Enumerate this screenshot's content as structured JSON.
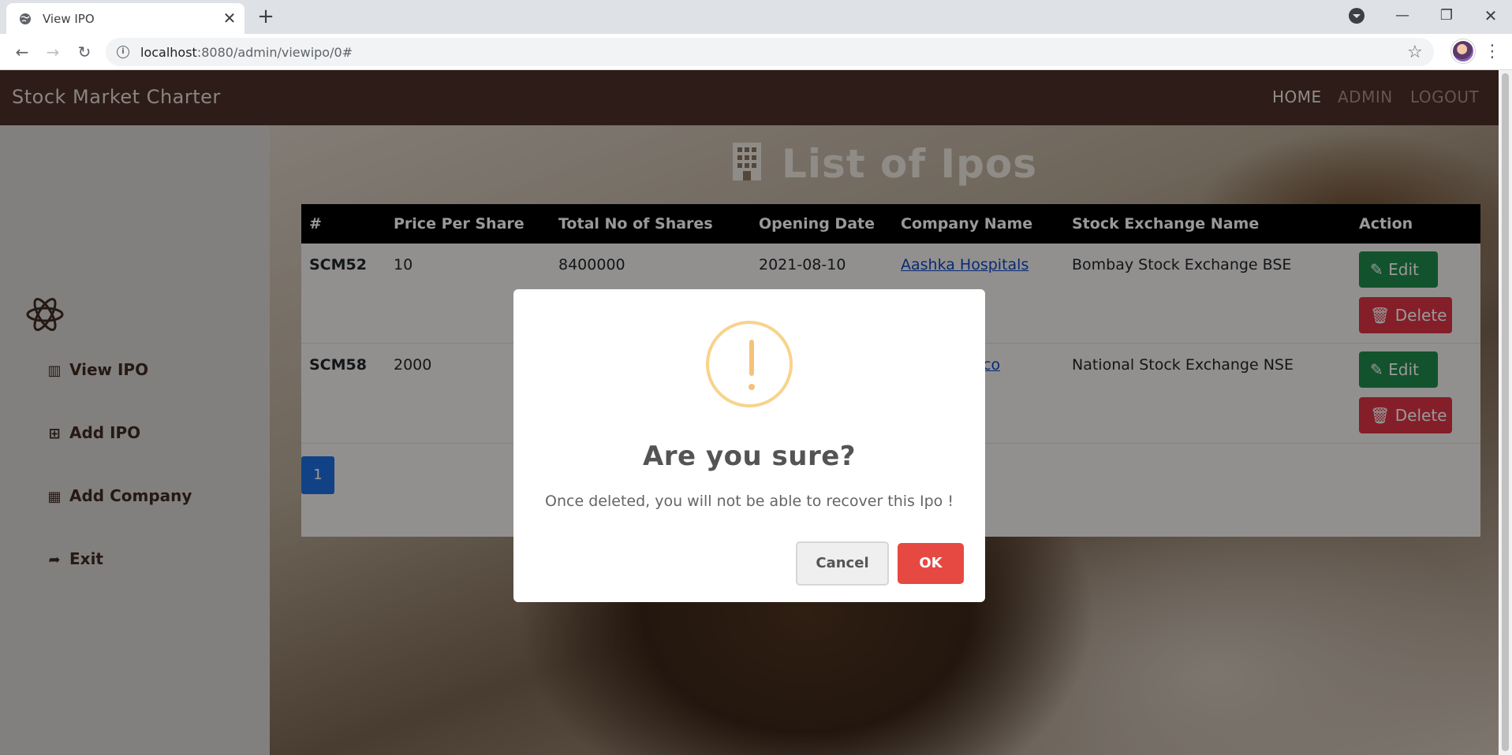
{
  "browser": {
    "tab_title": "View IPO",
    "url_host": "localhost",
    "url_path": ":8080/admin/viewipo/0#",
    "icons": {
      "tab_favicon": "globe-icon",
      "close": "close-icon",
      "new_tab": "plus-icon",
      "back": "arrow-left-icon",
      "forward": "arrow-right-icon",
      "reload": "reload-icon",
      "info": "info-icon",
      "bookmark": "star-icon",
      "menu": "kebab-menu-icon"
    }
  },
  "navbar": {
    "brand": "Stock Market Charter",
    "links": [
      "HOME",
      "ADMIN",
      "LOGOUT"
    ],
    "background_color": "#4b3027"
  },
  "sidebar": {
    "items": [
      {
        "label": "View IPO",
        "icon": "building-icon"
      },
      {
        "label": "Add IPO",
        "icon": "plus-square-icon"
      },
      {
        "label": "Add Company",
        "icon": "building-outline-icon"
      },
      {
        "label": "Exit",
        "icon": "sign-out-icon"
      }
    ]
  },
  "main": {
    "title": "List of Ipos",
    "table": {
      "headers": [
        "#",
        "Price Per Share",
        "Total No of Shares",
        "Opening Date",
        "Company Name",
        "Stock Exchange Name",
        "Action"
      ],
      "rows": [
        {
          "id": "SCM52",
          "price": "10",
          "shares": "8400000",
          "date": "2021-08-10",
          "company": "Aashka Hospitals",
          "exchange": "Bombay Stock Exchange BSE"
        },
        {
          "id": "SCM58",
          "price": "2000",
          "shares": "",
          "date": "",
          "company": "co",
          "exchange": "National Stock Exchange NSE"
        }
      ],
      "edit_label": "Edit",
      "delete_label": "Delete"
    },
    "pagination": {
      "current_page": "1"
    }
  },
  "modal": {
    "icon": "warning-icon",
    "title": "Are you sure?",
    "text": "Once deleted, you will not be able to recover this Ipo !",
    "cancel_label": "Cancel",
    "ok_label": "OK"
  },
  "colors": {
    "edit": "#1e8a4c",
    "delete": "#dc3545",
    "ok": "#e64942",
    "warning": "#f8d38b",
    "page_active": "#1f6fe0"
  }
}
